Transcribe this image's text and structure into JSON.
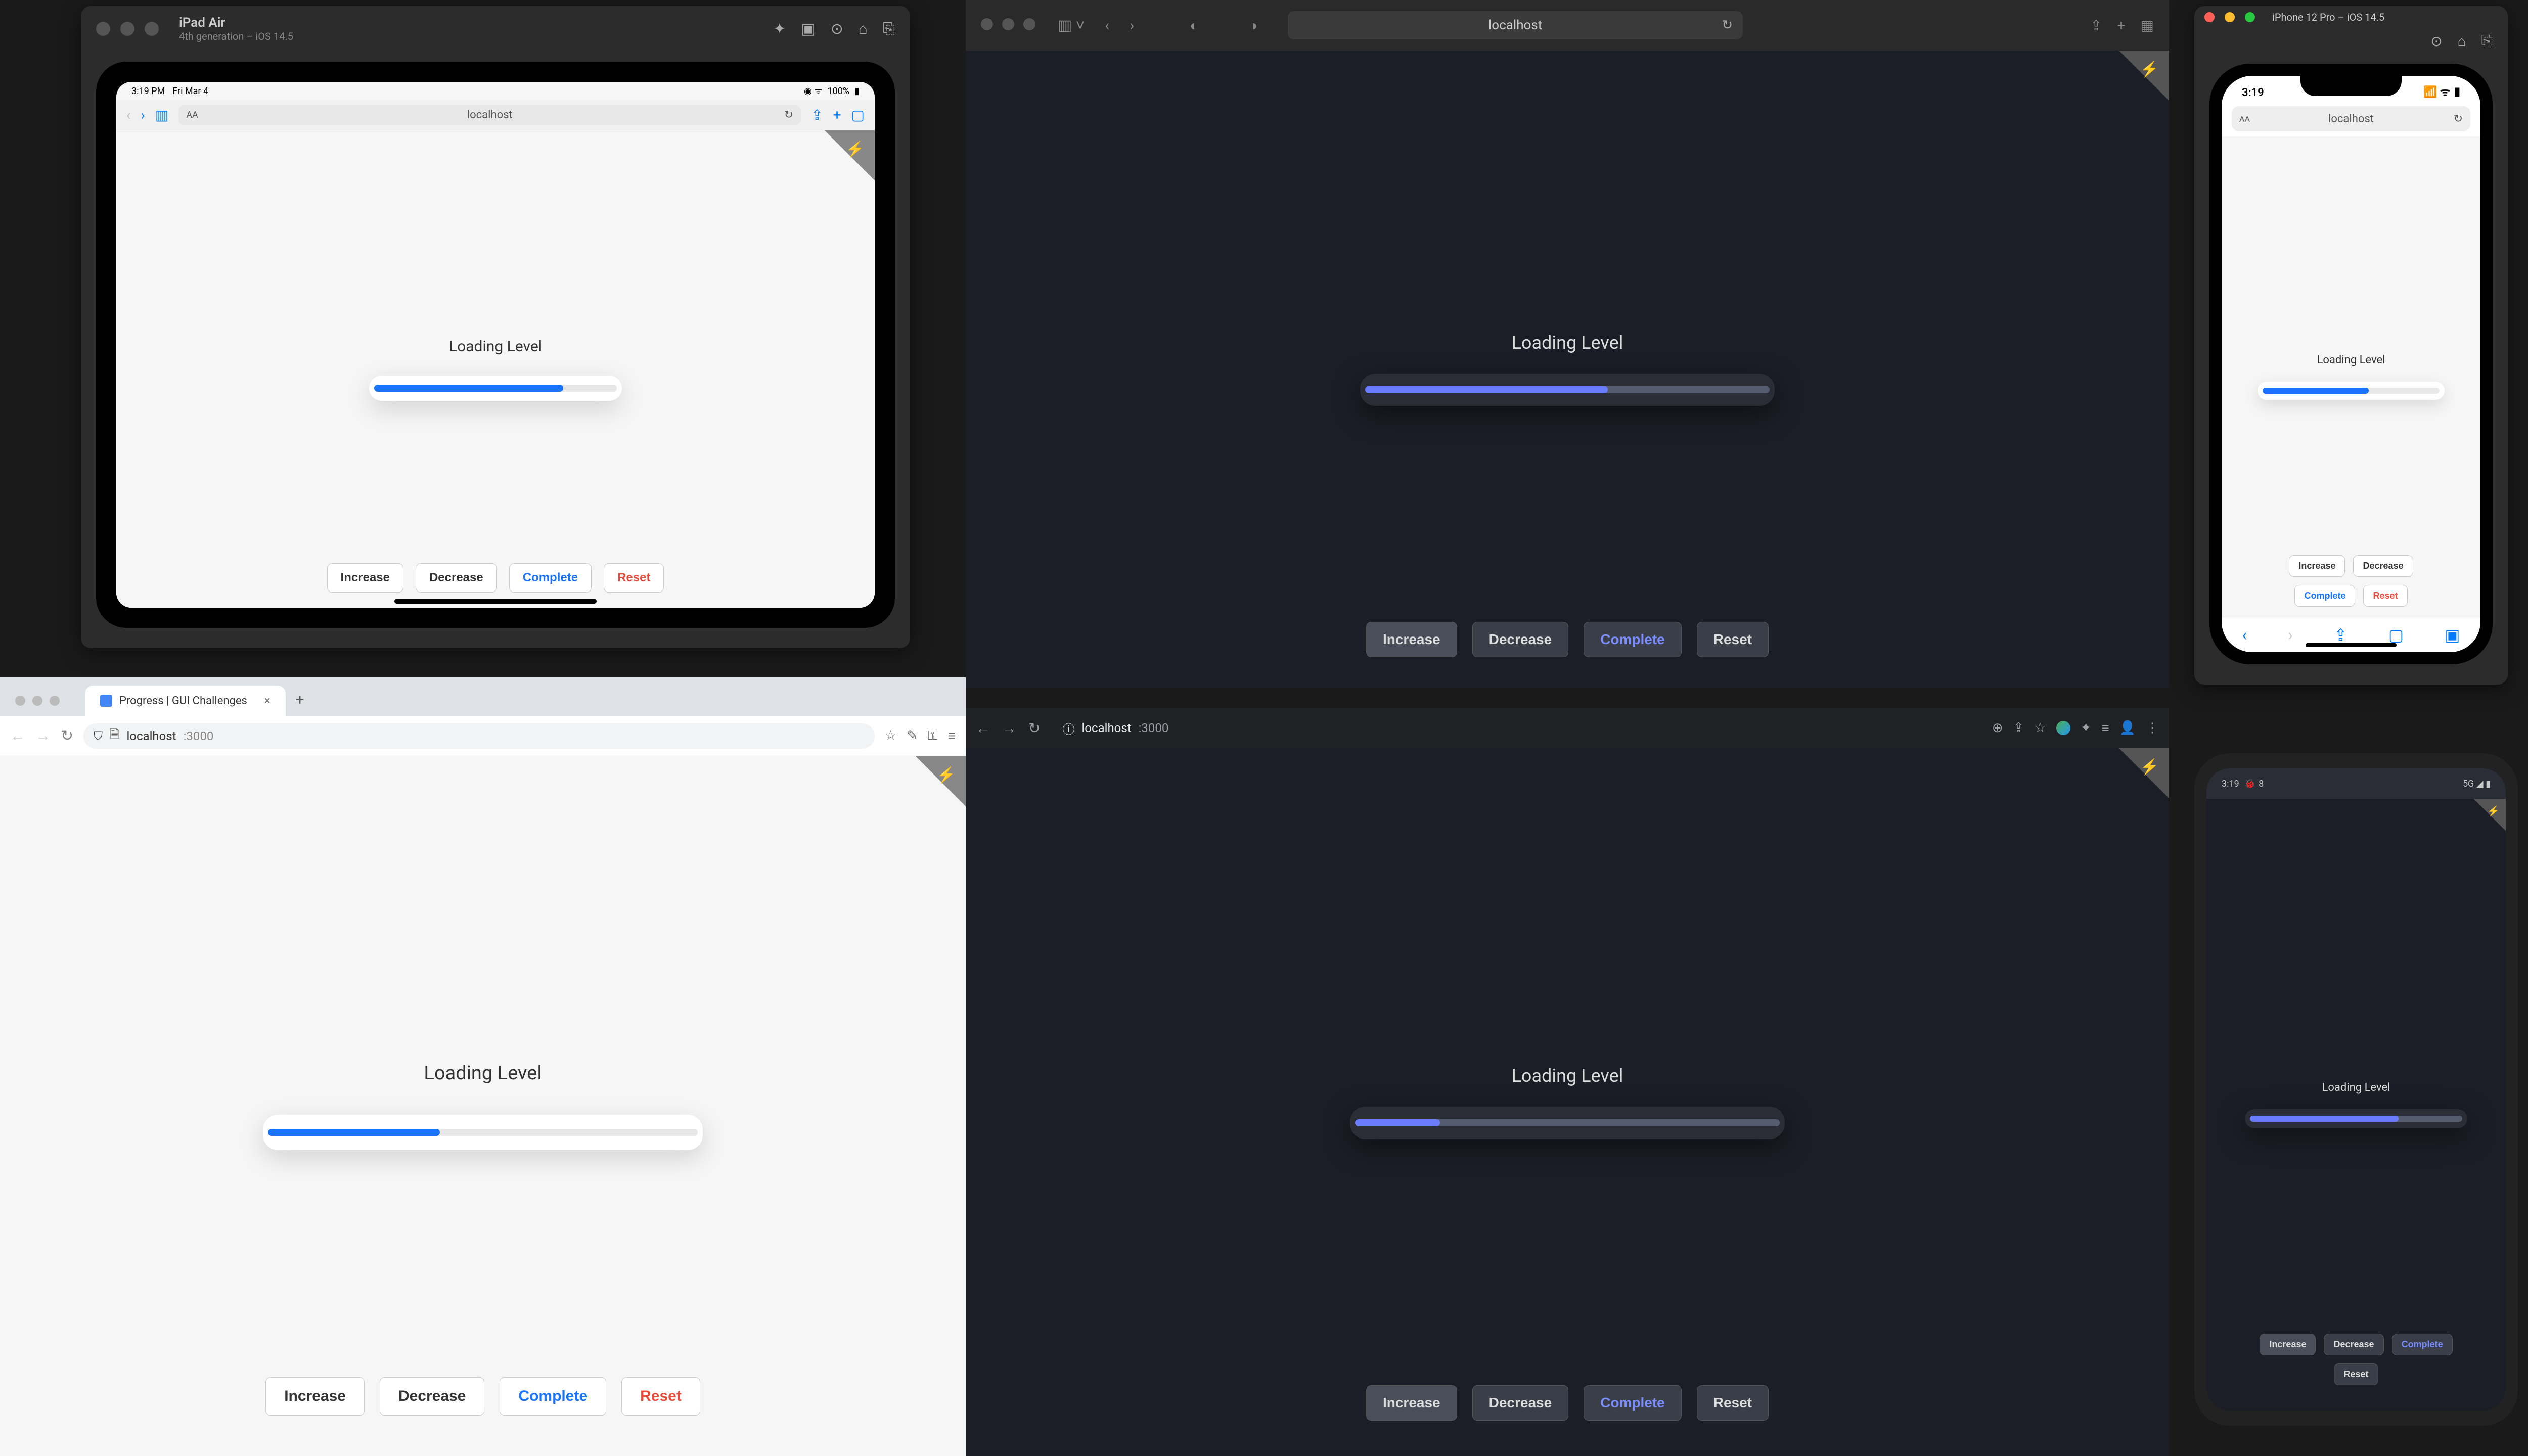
{
  "demo": {
    "label": "Loading Level",
    "buttons": {
      "increase": "Increase",
      "decrease": "Decrease",
      "complete": "Complete",
      "reset": "Reset"
    }
  },
  "progress": {
    "ipad_pct": 78,
    "safari_pct": 60,
    "iphone_pct": 60,
    "chrome_light_pct": 40,
    "chrome_dark_pct": 20,
    "android_pct": 70
  },
  "ipad": {
    "title": "iPad Air",
    "subtitle": "4th generation – iOS 14.5",
    "status_time": "3:19 PM",
    "status_date": "Fri Mar 4",
    "status_wifi": "100%",
    "url": "localhost"
  },
  "safari": {
    "url": "localhost"
  },
  "iphone": {
    "title": "iPhone 12 Pro – iOS 14.5",
    "status_time": "3:19",
    "url": "localhost"
  },
  "chrome_light": {
    "tab_title": "Progress | GUI Challenges",
    "url_host": "localhost",
    "url_port": ":3000"
  },
  "chrome_dark": {
    "url_host": "localhost",
    "url_port": ":3000"
  },
  "android": {
    "status_time": "3:19",
    "status_debug": "8"
  }
}
